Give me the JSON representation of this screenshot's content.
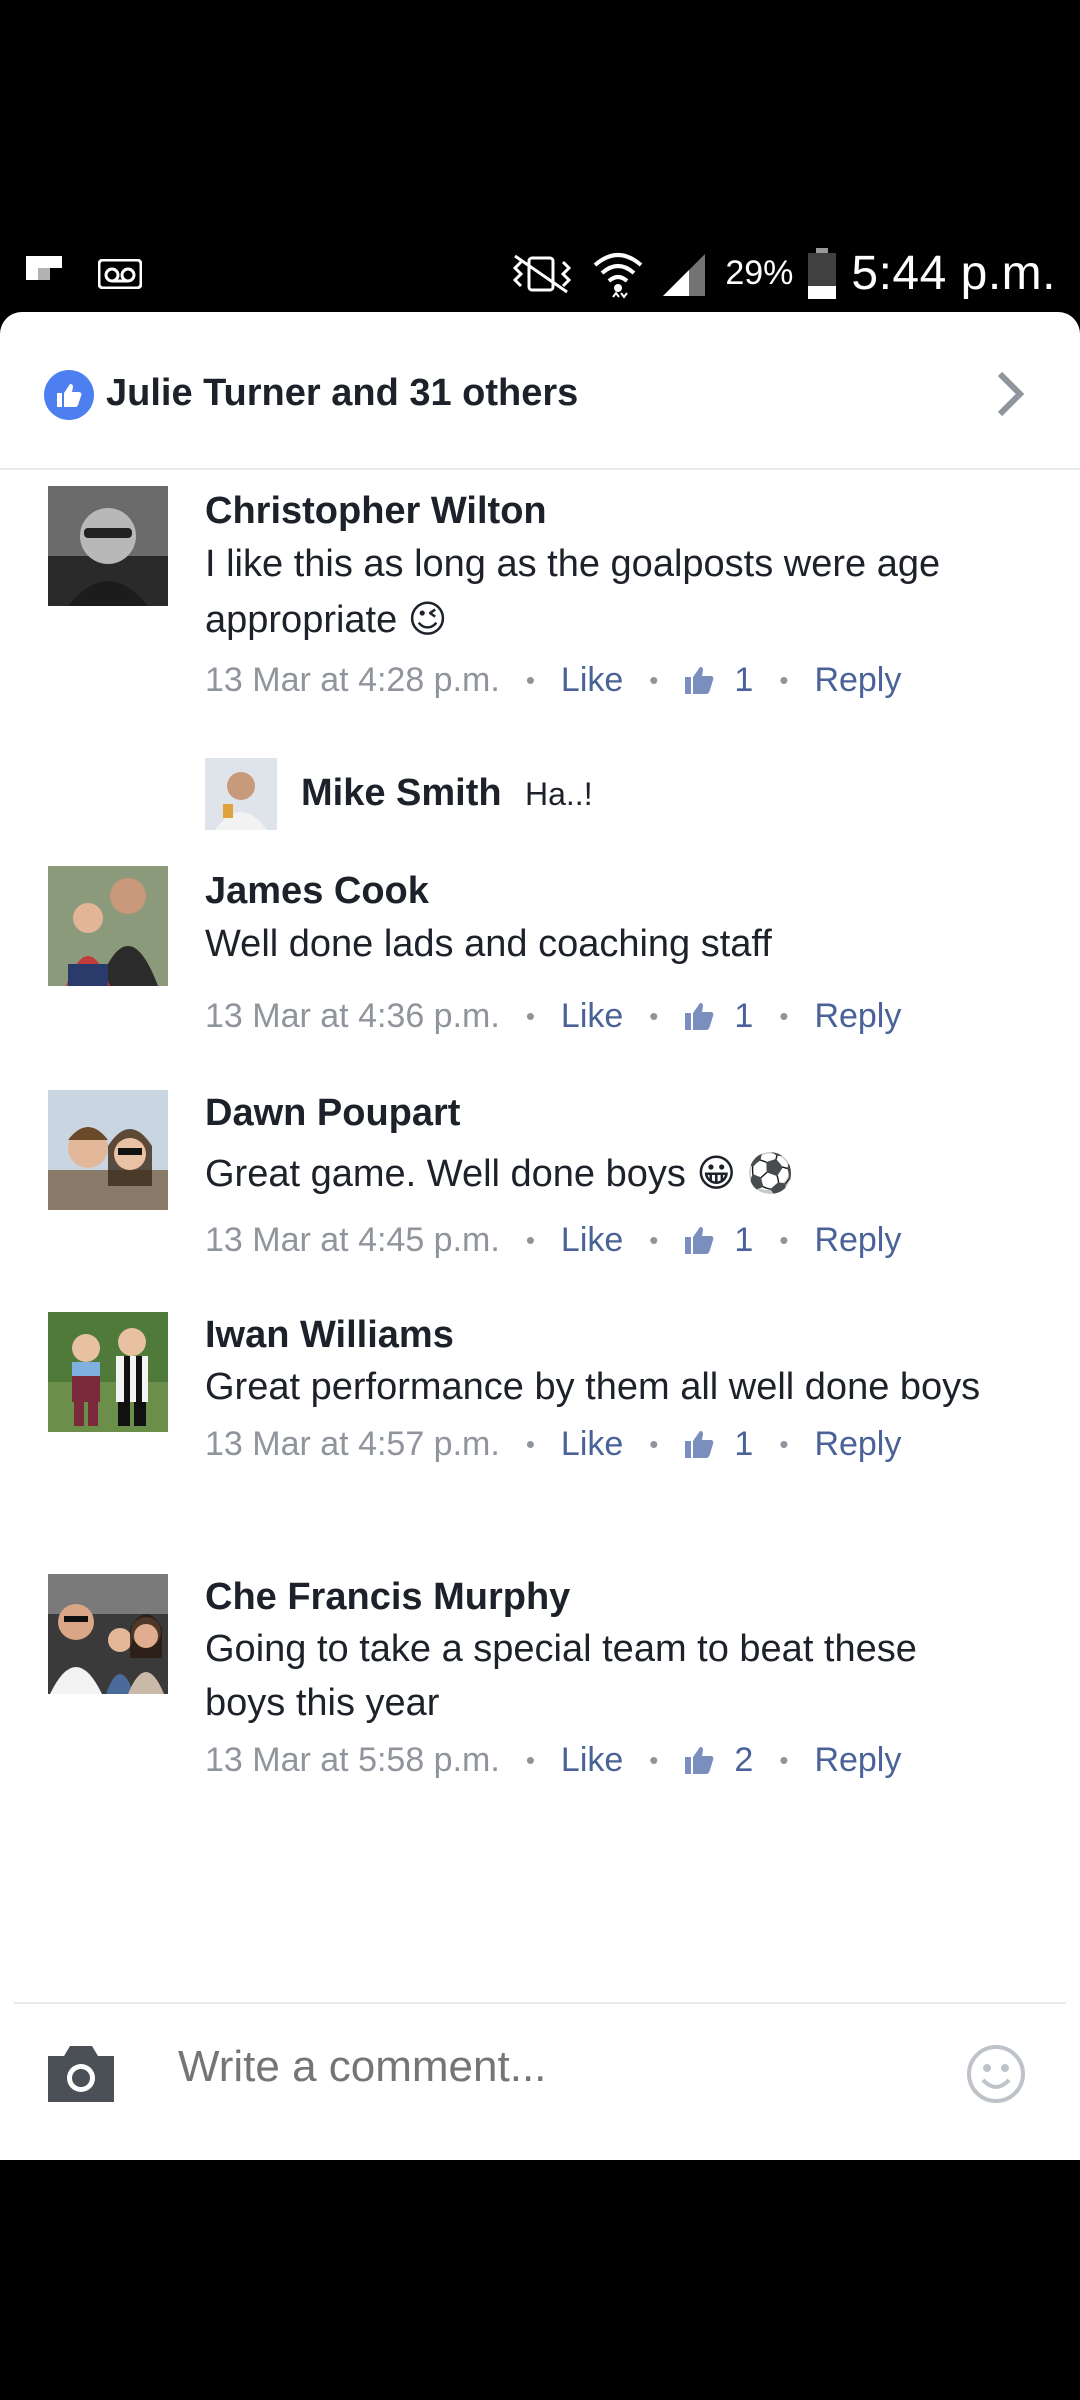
{
  "status_bar": {
    "left_icons": [
      "flipboard-icon",
      "voicemail-icon"
    ],
    "right_icons": [
      "vibrate-icon",
      "wifi-icon",
      "signal-icon",
      "battery-icon"
    ],
    "battery_percent": "29%",
    "time": "5:44 p.m."
  },
  "likes_header": {
    "text": "Julie Turner and 31 others",
    "icon": "like-badge-icon",
    "chevron": "chevron-right-icon"
  },
  "comments": [
    {
      "author": "Christopher Wilton",
      "text": "I like this as long as the goalposts were age appropriate 😉",
      "time": "13 Mar at 4:28 p.m.",
      "like_label": "Like",
      "like_count": "1",
      "reply_label": "Reply"
    },
    {
      "author": "James Cook",
      "text": "Well done lads and coaching staff",
      "time": "13 Mar at 4:36 p.m.",
      "like_label": "Like",
      "like_count": "1",
      "reply_label": "Reply"
    },
    {
      "author": "Dawn Poupart",
      "text": "Great game.  Well done boys 😀 ⚽",
      "time": "13 Mar at 4:45 p.m.",
      "like_label": "Like",
      "like_count": "1",
      "reply_label": "Reply"
    },
    {
      "author": "Iwan Williams",
      "text": "Great performance by them all well done boys",
      "time": "13 Mar at 4:57 p.m.",
      "like_label": "Like",
      "like_count": "1",
      "reply_label": "Reply"
    },
    {
      "author": "Che Francis Murphy",
      "text": "Going to take a special team to beat these boys this year",
      "time": "13 Mar at 5:58 p.m.",
      "like_label": "Like",
      "like_count": "2",
      "reply_label": "Reply"
    }
  ],
  "reply_preview": {
    "author": "Mike Smith",
    "text": "Ha..!"
  },
  "composer": {
    "placeholder": "Write a comment...",
    "camera_icon": "camera-icon",
    "emoji_icon": "smiley-icon"
  },
  "colors": {
    "accent": "#4b6199",
    "like_badge": "#4d7ff0",
    "text": "#1d2129",
    "muted": "#90949c"
  }
}
